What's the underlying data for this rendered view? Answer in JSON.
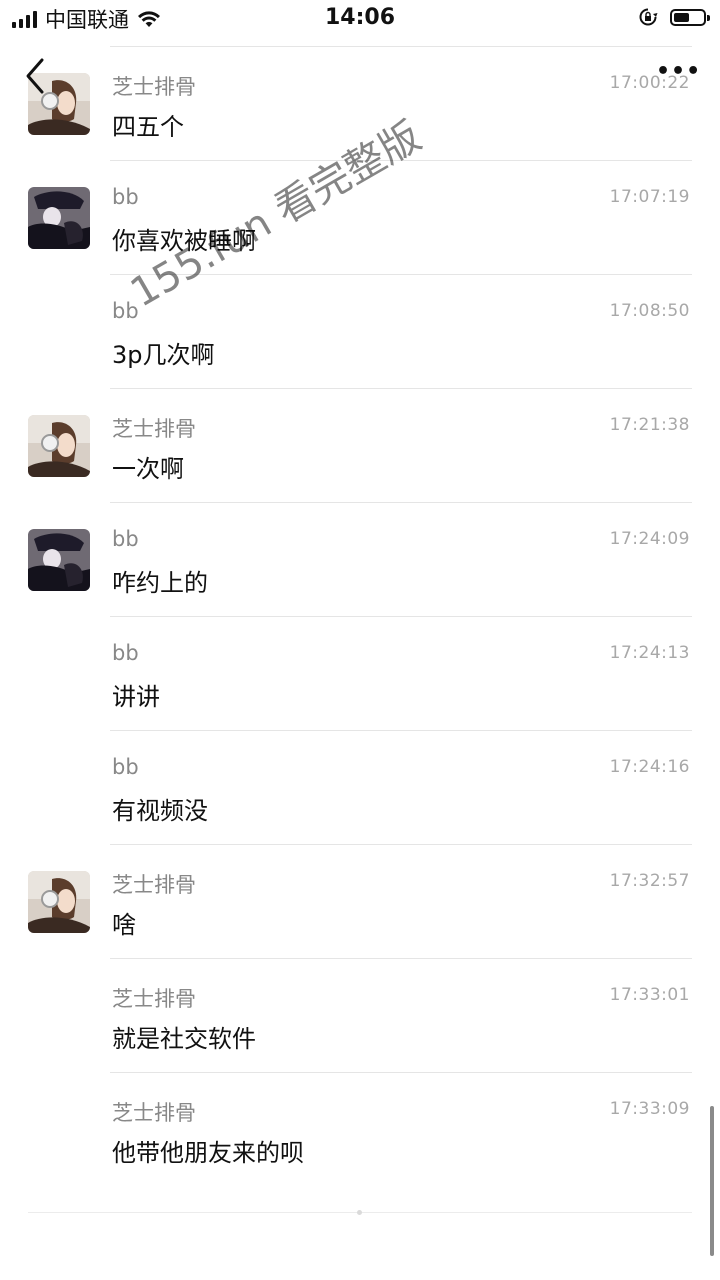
{
  "status_bar": {
    "carrier": "中国联通",
    "time": "14:06",
    "signal_bars": 4,
    "icons": [
      "signal-icon",
      "wifi-icon",
      "rotation-lock-icon",
      "battery-icon"
    ]
  },
  "nav": {
    "back_icon": "chevron-left-icon",
    "more_icon": "more-dots-icon",
    "more_label": "•••"
  },
  "messages": [
    {
      "sender": "芝士排骨",
      "time": "17:00:22",
      "text": "四五个",
      "avatar": "cheese"
    },
    {
      "sender": "bb",
      "time": "17:07:19",
      "text": "你喜欢被睡啊",
      "avatar": "bb"
    },
    {
      "sender": "bb",
      "time": "17:08:50",
      "text": "3p几次啊",
      "avatar": ""
    },
    {
      "sender": "芝士排骨",
      "time": "17:21:38",
      "text": "一次啊",
      "avatar": "cheese"
    },
    {
      "sender": "bb",
      "time": "17:24:09",
      "text": "咋约上的",
      "avatar": "bb"
    },
    {
      "sender": "bb",
      "time": "17:24:13",
      "text": "讲讲",
      "avatar": ""
    },
    {
      "sender": "bb",
      "time": "17:24:16",
      "text": "有视频没",
      "avatar": ""
    },
    {
      "sender": "芝士排骨",
      "time": "17:32:57",
      "text": "啥",
      "avatar": "cheese"
    },
    {
      "sender": "芝士排骨",
      "time": "17:33:01",
      "text": "就是社交软件",
      "avatar": ""
    },
    {
      "sender": "芝士排骨",
      "time": "17:33:09",
      "text": "他带他朋友来的呗",
      "avatar": ""
    }
  ],
  "watermark": "155.fun 看完整版"
}
